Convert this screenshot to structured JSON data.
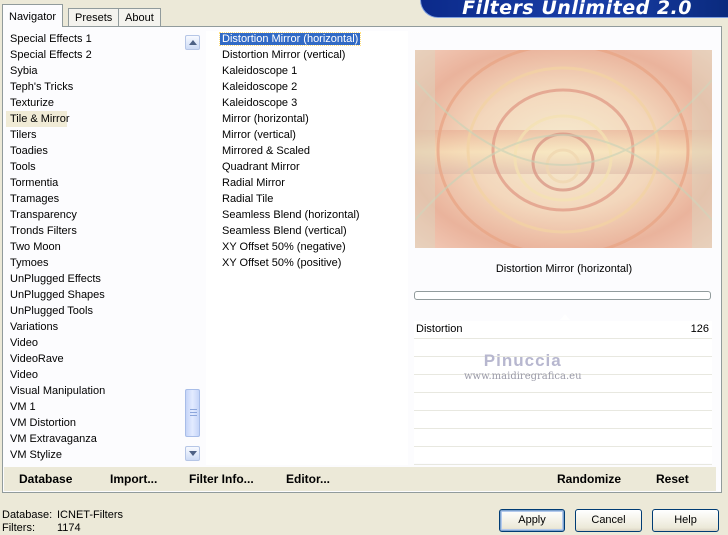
{
  "tabs": [
    "Navigator",
    "Presets",
    "About"
  ],
  "banner_title": "Filters Unlimited 2.0",
  "categories": [
    "Special Effects 1",
    "Special Effects 2",
    "Sybia",
    "Teph's Tricks",
    "Texturize",
    "Tile & Mirror",
    "Tilers",
    "Toadies",
    "Tools",
    "Tormentia",
    "Tramages",
    "Transparency",
    "Tronds Filters",
    "Two Moon",
    "Tymoes",
    "UnPlugged Effects",
    "UnPlugged Shapes",
    "UnPlugged Tools",
    "Variations",
    "Video",
    "VideoRave",
    "Video",
    "Visual Manipulation",
    "VM 1",
    "VM Distortion",
    "VM Extravaganza",
    "VM Stylize"
  ],
  "selected_category": "Tile & Mirror",
  "filters": [
    "Distortion Mirror (horizontal)",
    "Distortion Mirror (vertical)",
    "Kaleidoscope 1",
    "Kaleidoscope 2",
    "Kaleidoscope 3",
    "Mirror (horizontal)",
    "Mirror (vertical)",
    "Mirrored & Scaled",
    "Quadrant Mirror",
    "Radial Mirror",
    "Radial Tile",
    "Seamless Blend (horizontal)",
    "Seamless Blend (vertical)",
    "XY Offset 50% (negative)",
    "XY Offset 50% (positive)"
  ],
  "selected_filter": "Distortion Mirror (horizontal)",
  "preview_filter_name": "Distortion Mirror (horizontal)",
  "control": {
    "label": "Distortion",
    "value": "126"
  },
  "watermark": {
    "line1": "Pinuccia",
    "line2": "www.maidiregrafica.eu"
  },
  "bottom_links": {
    "database": "Database",
    "import": "Import...",
    "filter_info": "Filter Info...",
    "editor": "Editor...",
    "randomize": "Randomize",
    "reset": "Reset"
  },
  "status": {
    "database_label": "Database:",
    "database_value": "ICNET-Filters",
    "filters_label": "Filters:",
    "filters_value": "1174"
  },
  "buttons": {
    "apply": "Apply",
    "cancel": "Cancel",
    "help": "Help"
  },
  "colors": {
    "selection": "#316ac5",
    "banner": "#0b2a8a",
    "window_bg": "#ece9d8"
  }
}
